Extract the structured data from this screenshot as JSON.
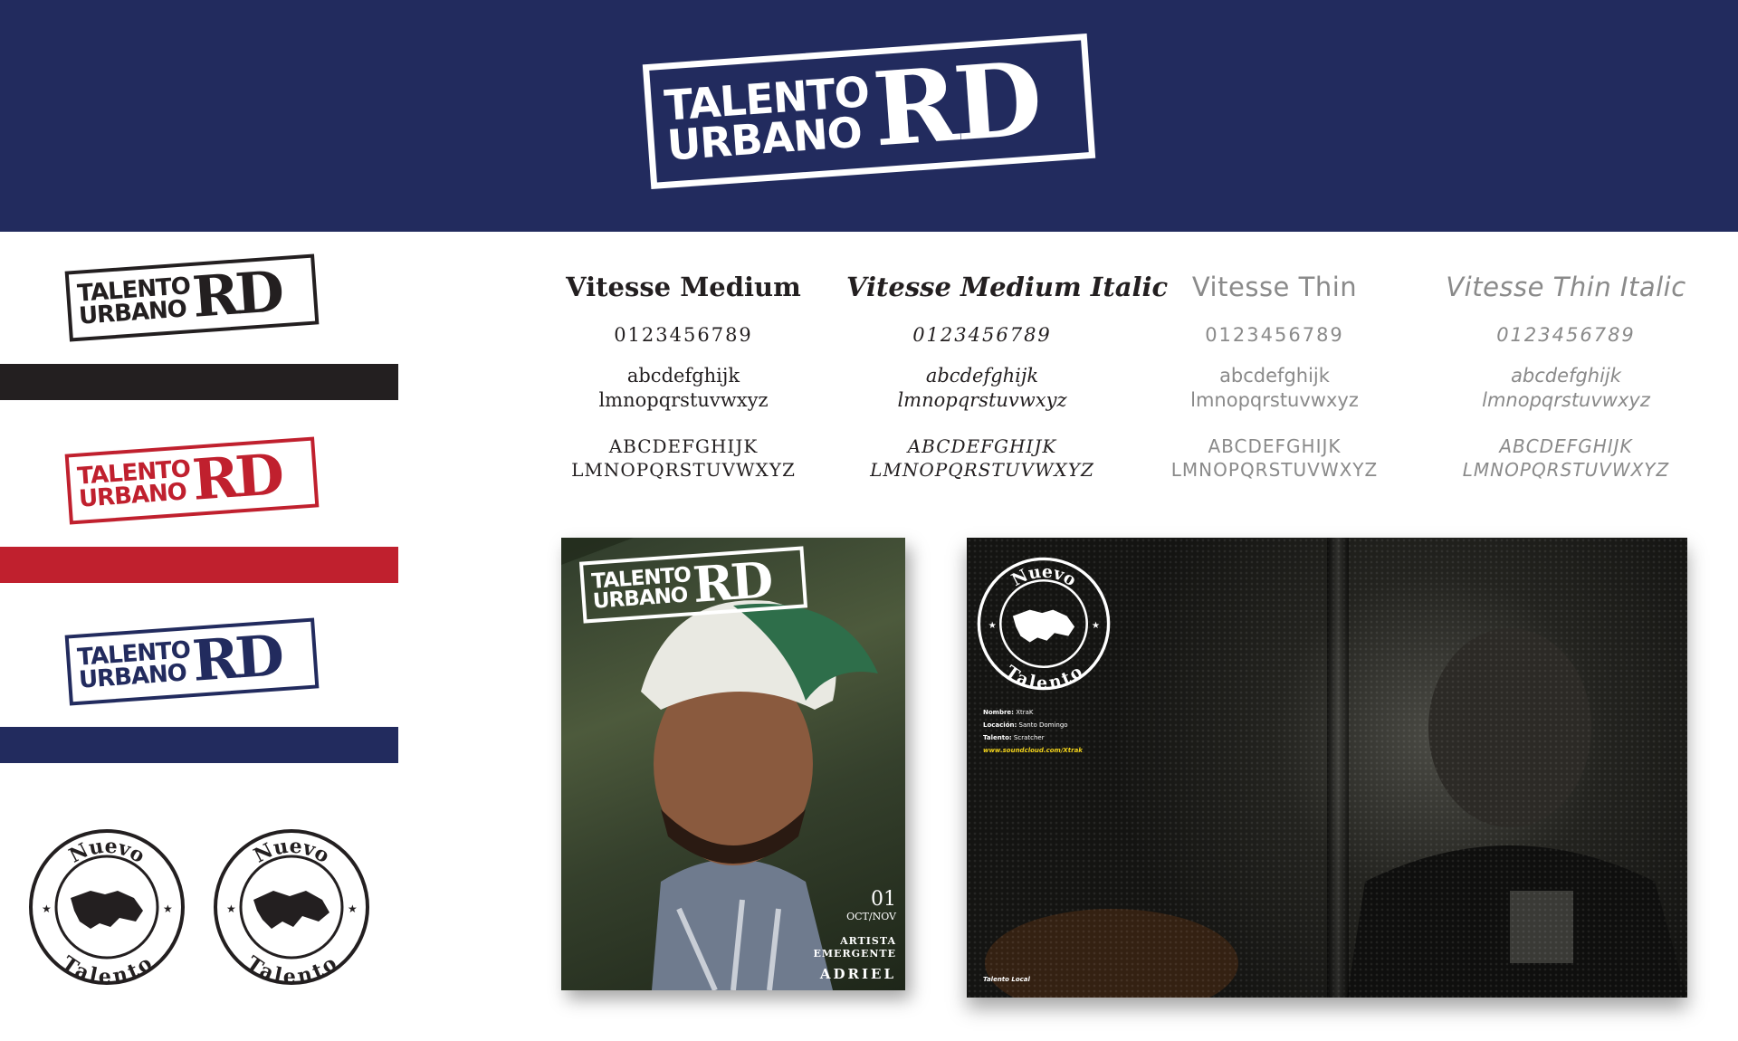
{
  "logo": {
    "line1": "TALENTO",
    "line2": "URBANO",
    "mark": "RD"
  },
  "colors": {
    "navy": "#222b5e",
    "red": "#c0202e",
    "black": "#231f20",
    "white": "#ffffff"
  },
  "badge": {
    "top": "Nuevo",
    "bottom": "Talento"
  },
  "typefaces": [
    {
      "name": "Vitesse Medium",
      "digits": "0123456789",
      "lower1": "abcdefghijk",
      "lower2": "lmnopqrstuvwxyz",
      "upper1": "ABCDEFGHIJK",
      "upper2": "LMNOPQRSTUVWXYZ"
    },
    {
      "name": "Vitesse Medium Italic",
      "digits": "0123456789",
      "lower1": "abcdefghijk",
      "lower2": "lmnopqrstuvwxyz",
      "upper1": "ABCDEFGHIJK",
      "upper2": "LMNOPQRSTUVWXYZ"
    },
    {
      "name": "Vitesse Thin",
      "digits": "0123456789",
      "lower1": "abcdefghijk",
      "lower2": "lmnopqrstuvwxyz",
      "upper1": "ABCDEFGHIJK",
      "upper2": "LMNOPQRSTUVWXYZ"
    },
    {
      "name": "Vitesse Thin Italic",
      "digits": "0123456789",
      "lower1": "abcdefghijk",
      "lower2": "lmnopqrstuvwxyz",
      "upper1": "ABCDEFGHIJK",
      "upper2": "LMNOPQRSTUVWXYZ"
    }
  ],
  "cover": {
    "issue": "01",
    "date": "OCT/NOV",
    "kicker1": "ARTISTA",
    "kicker2": "EMERGENTE",
    "artist": "ADRIEL"
  },
  "spread": {
    "nombre_label": "Nombre:",
    "nombre": "XtraK",
    "locacion_label": "Locación:",
    "locacion": "Santo Domingo",
    "talento_label": "Talento:",
    "talento": "Scratcher",
    "url": "www.soundcloud.com/Xtrak",
    "footer": "Talento Local"
  }
}
